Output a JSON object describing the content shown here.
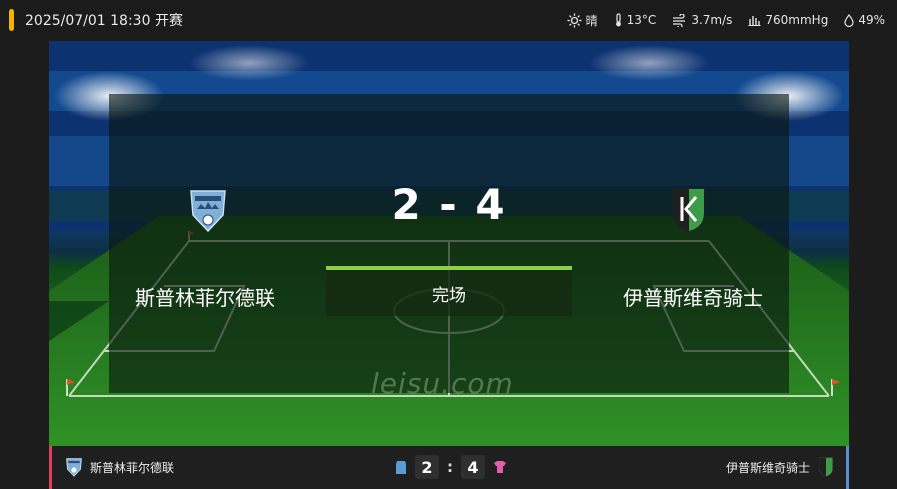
{
  "header": {
    "datetime": "2025/07/01 18:30",
    "status": "开赛",
    "weather": {
      "condition": "晴",
      "temperature": "13°C",
      "wind": "3.7m/s",
      "pressure": "760mmHg",
      "humidity": "49%"
    }
  },
  "match": {
    "home_team": "斯普林菲尔德联",
    "away_team": "伊普斯维奇骑士",
    "score": "2 - 4",
    "home_score": "2",
    "away_score": "4",
    "state": "完场"
  },
  "watermark": "leisu.com",
  "colors": {
    "accent": "#f5b300",
    "status_bar": "#8fcf45",
    "home_border": "#e0405e",
    "away_border": "#5a8fd8",
    "home_shirt": "#5b9bd5",
    "away_shirt": "#e05fa8"
  }
}
